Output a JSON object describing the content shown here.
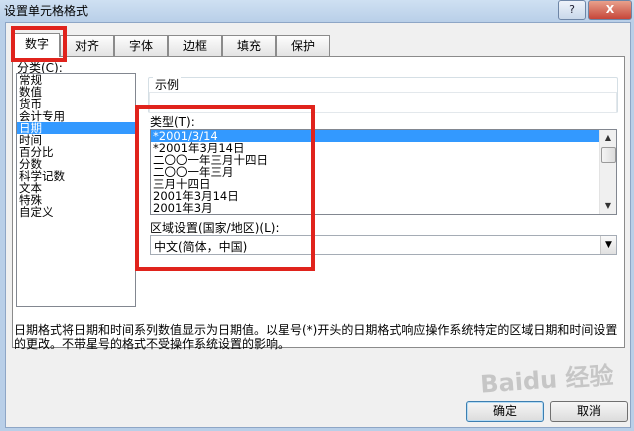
{
  "window": {
    "title": "设置单元格格式",
    "help_label": "?",
    "close_label": "X"
  },
  "tabs": [
    {
      "label": "数字",
      "active": true
    },
    {
      "label": "对齐"
    },
    {
      "label": "字体"
    },
    {
      "label": "边框"
    },
    {
      "label": "填充"
    },
    {
      "label": "保护"
    }
  ],
  "category": {
    "label": "分类(C):",
    "items": [
      "常规",
      "数值",
      "货币",
      "会计专用",
      "日期",
      "时间",
      "百分比",
      "分数",
      "科学记数",
      "文本",
      "特殊",
      "自定义"
    ],
    "selected": "日期"
  },
  "sample": {
    "label": "示例",
    "value": ""
  },
  "type": {
    "label": "类型(T):",
    "items": [
      "*2001/3/14",
      "*2001年3月14日",
      "二〇〇一年三月十四日",
      "二〇〇一年三月",
      "三月十四日",
      "2001年3月14日",
      "2001年3月"
    ],
    "selected": "*2001/3/14"
  },
  "locale": {
    "label": "区域设置(国家/地区)(L):",
    "value": "中文(简体，中国)"
  },
  "description": "日期格式将日期和时间系列数值显示为日期值。以星号(*)开头的日期格式响应操作系统特定的区域日期和时间设置的更改。不带星号的格式不受操作系统设置的影响。",
  "buttons": {
    "ok": "确定",
    "cancel": "取消"
  },
  "watermark": "Baidu 经验",
  "colors": {
    "highlight": "#e0231c",
    "selection": "#3399ff"
  }
}
